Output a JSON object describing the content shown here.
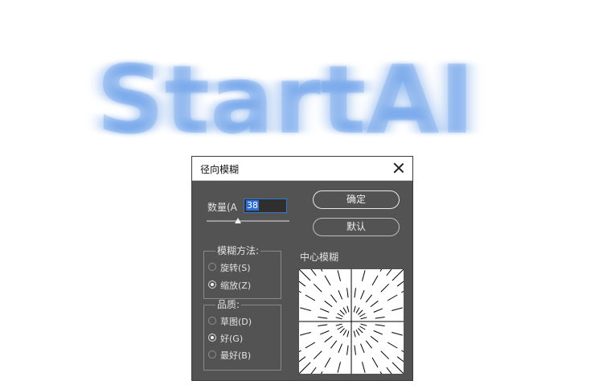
{
  "background": {
    "logo_text": "StartAI",
    "logo_color": "#6fa3ea"
  },
  "dialog": {
    "title": "径向模糊",
    "close_icon": "close-icon",
    "amount": {
      "label": "数量(A",
      "value": "38",
      "slider_value": 38,
      "slider_max": 100
    },
    "buttons": {
      "ok_label": "确定",
      "default_label": "默认"
    },
    "blur_method": {
      "legend": "模糊方法:",
      "options": [
        {
          "label": "旋转(S)",
          "checked": false
        },
        {
          "label": "缩放(Z)",
          "checked": true
        }
      ]
    },
    "quality": {
      "legend": "品质:",
      "options": [
        {
          "label": "草图(D)",
          "checked": false
        },
        {
          "label": "好(G)",
          "checked": true
        },
        {
          "label": "最好(B)",
          "checked": false
        }
      ]
    },
    "center_label": "中心模糊"
  }
}
